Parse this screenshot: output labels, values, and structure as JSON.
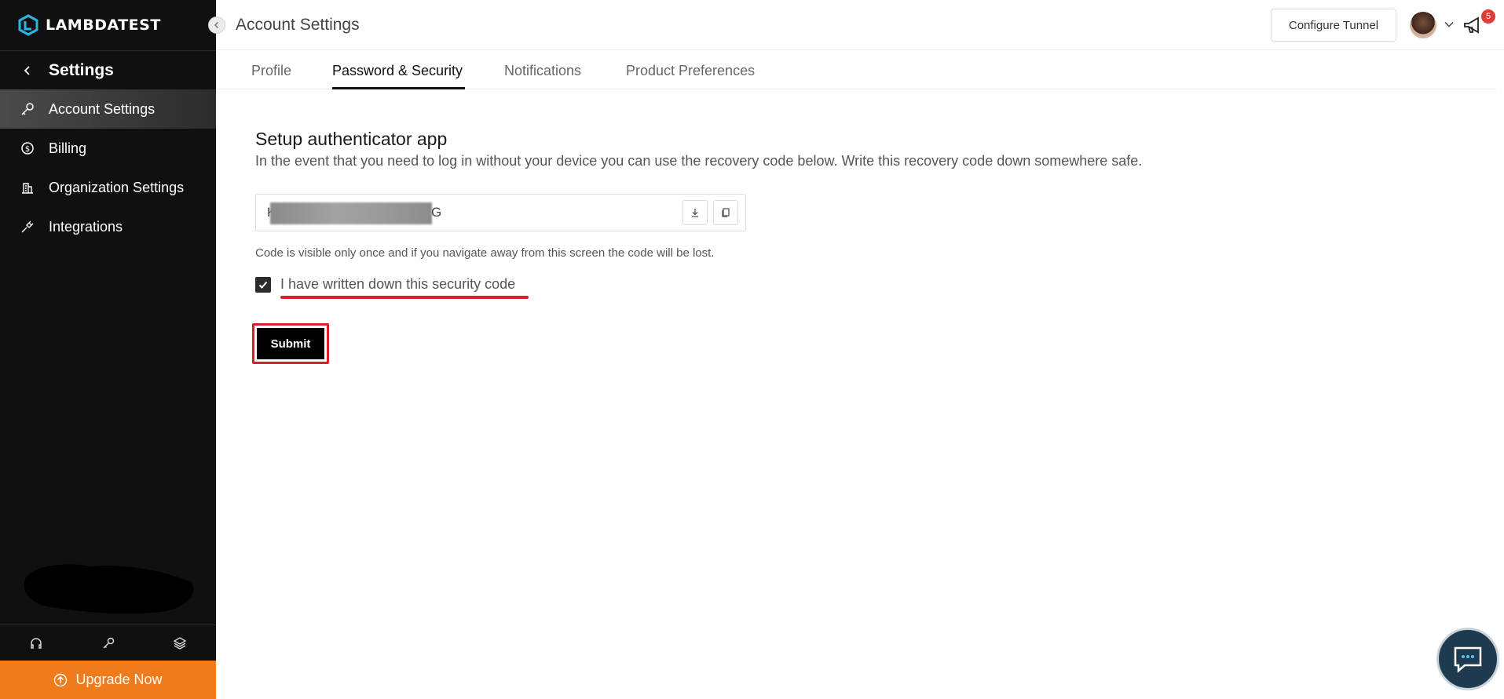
{
  "brand": {
    "name": "LAMBDATEST",
    "accent": "#f07b1c"
  },
  "sidebar": {
    "title": "Settings",
    "items": [
      {
        "label": "Account Settings",
        "icon": "key-icon",
        "active": true
      },
      {
        "label": "Billing",
        "icon": "dollar-circle-icon",
        "active": false
      },
      {
        "label": "Organization Settings",
        "icon": "building-icon",
        "active": false
      },
      {
        "label": "Integrations",
        "icon": "plug-icon",
        "active": false
      }
    ],
    "bottom_icons": [
      "headset-icon",
      "key-icon",
      "layers-icon"
    ],
    "upgrade_label": "Upgrade Now"
  },
  "header": {
    "title": "Account Settings",
    "configure_label": "Configure Tunnel",
    "notification_count": "5"
  },
  "tabs": [
    {
      "label": "Profile",
      "active": false
    },
    {
      "label": "Password & Security",
      "active": true
    },
    {
      "label": "Notifications",
      "active": false
    },
    {
      "label": "Product Preferences",
      "active": false
    }
  ],
  "security": {
    "title": "Setup authenticator app",
    "description": "In the event that you need to log in without your device you can use the recovery code below. Write this recovery code down somewhere safe.",
    "code_start": "K",
    "code_end": "G",
    "hint": "Code is visible only once and if you navigate away from this screen the code will be lost.",
    "checkbox_label": "I have written down this security code",
    "checkbox_checked": true,
    "submit_label": "Submit"
  }
}
